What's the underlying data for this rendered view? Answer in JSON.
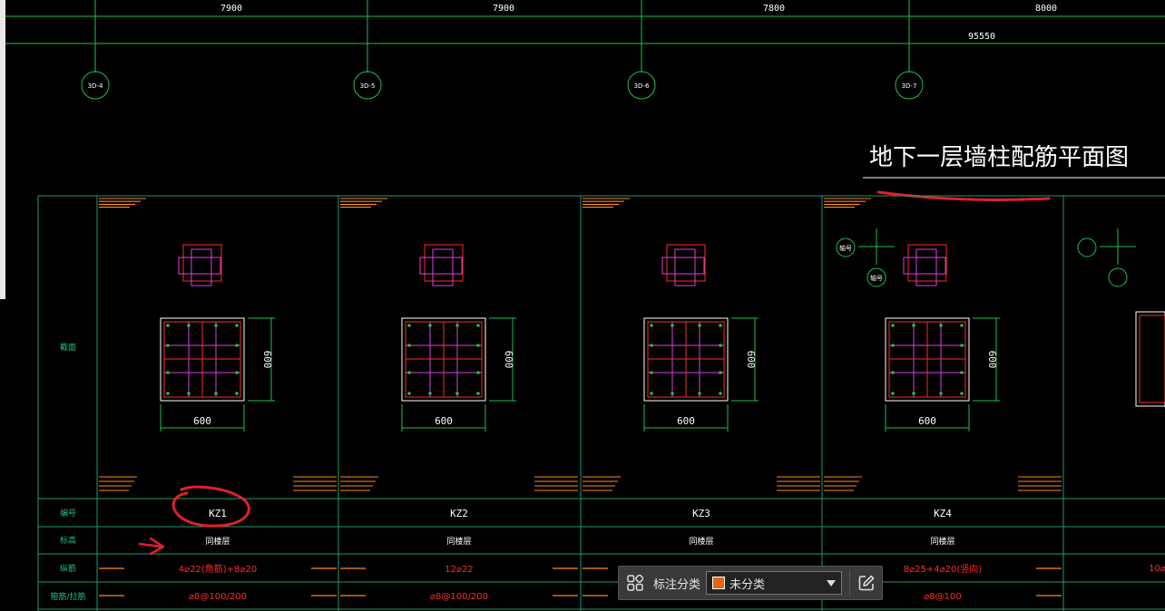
{
  "dimensions": {
    "spans": [
      "7900",
      "7900",
      "7800",
      "8000"
    ],
    "total": "95550"
  },
  "axes": [
    "3D-4",
    "3D-5",
    "3D-6",
    "3D-7"
  ],
  "drawing_title": "地下一层墙柱配筋平面图",
  "row_labels": {
    "section": "截面",
    "number": "编号",
    "layer": "标高",
    "longitudinal": "纵筋",
    "stirrup": "箍筋/拉筋"
  },
  "columns": [
    {
      "name": "KZ1",
      "section_w": "600",
      "section_h": "600",
      "layer": "同楼层",
      "rebar": "4⌀22(角筋)+8⌀20",
      "stirrup": "⌀8@100/200"
    },
    {
      "name": "KZ2",
      "section_w": "600",
      "section_h": "600",
      "layer": "同楼层",
      "rebar": "12⌀22",
      "stirrup": "⌀8@100/200"
    },
    {
      "name": "KZ3",
      "section_w": "600",
      "section_h": "600",
      "layer": "同楼层",
      "rebar": "",
      "stirrup": ""
    },
    {
      "name": "KZ4",
      "section_w": "600",
      "section_h": "600",
      "layer": "同楼层",
      "rebar": "8⌀25+4⌀20(竖向)",
      "stirrup": "⌀8@100"
    }
  ],
  "partial_rebar": "10⌀",
  "axis_marker_labels": [
    "轴号",
    "轴号"
  ],
  "toolbar": {
    "label": "标注分类",
    "selected": "未分类",
    "swatch_color": "#e8640c"
  },
  "colors": {
    "grid_line": "#21c04a",
    "table_line": "#1a9c6e",
    "rebar": "#ff2a2a",
    "stirrup": "#e040e0",
    "annotation": "#ff8a1a",
    "markup": "#e0202c"
  }
}
